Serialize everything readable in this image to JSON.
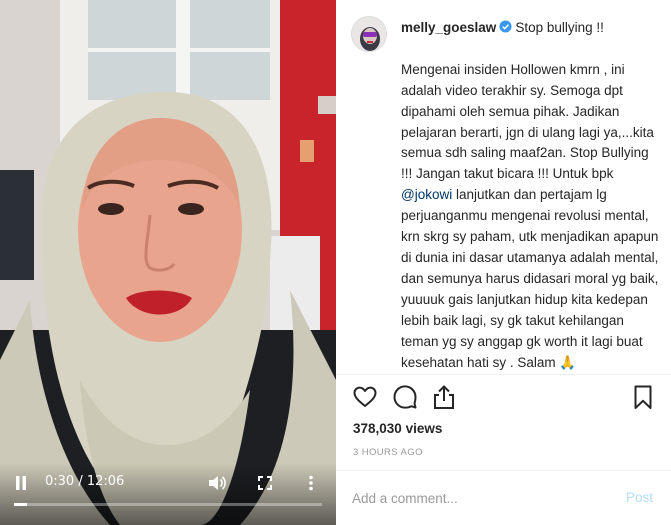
{
  "post": {
    "username": "melly_goeslaw",
    "verified": true,
    "caption_head": "Stop bullying !!",
    "caption_p1": "Mengenai insiden Hollowen kmrn , ini adalah video terakhir sy. Semoga dpt dipahami oleh semua pihak. Jadikan pelajaran berarti, jgn di ulang lagi ya,...kita semua sdh saling maaf2an. Stop Bullying !!! Jangan takut bicara !!! Untuk bpk ",
    "mention": "@jokowi",
    "caption_p2": " lanjutkan dan pertajam lg perjuanganmu mengenai revolusi mental, krn skrg sy paham, utk menjadikan apapun di dunia ini dasar utamanya adalah mental, dan semunya harus didasari moral yg baik, yuuuuk gais lanjutkan hidup kita kedepan lebih baik lagi, sy gk takut kehilangan teman yg sy anggap gk worth it lagi buat kesehatan hati sy . Salam ",
    "caption_emoji": "🙏",
    "views_count": "378,030",
    "views_label": " views",
    "timestamp": "3 HOURS AGO"
  },
  "video": {
    "current_time": "0:30",
    "separator": " / ",
    "duration": "12:06",
    "progress": 0.041
  },
  "icons": {
    "play": "pause-icon",
    "volume": "volume-icon",
    "fullscreen": "fullscreen-icon",
    "more": "more-vertical-icon",
    "like": "heart-icon",
    "comment": "comment-icon",
    "share": "share-icon",
    "save": "bookmark-icon"
  },
  "comment_box": {
    "placeholder": "Add a comment...",
    "post_label": "Post"
  },
  "colors": {
    "verified": "#3897f0",
    "mention": "#003569",
    "post_disabled": "#b2dffc"
  }
}
